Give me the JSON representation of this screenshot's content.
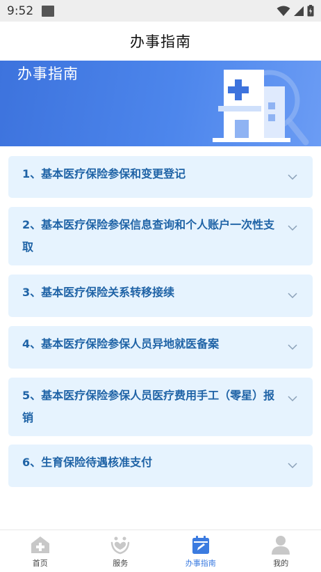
{
  "status_bar": {
    "time": "9:52"
  },
  "header": {
    "title": "办事指南"
  },
  "banner": {
    "title": "办事指南"
  },
  "guide_items": [
    {
      "label": "1、基本医疗保险参保和变更登记"
    },
    {
      "label": "2、基本医疗保险参保信息查询和个人账户一次性支取"
    },
    {
      "label": "3、基本医疗保险关系转移接续"
    },
    {
      "label": "4、基本医疗保险参保人员异地就医备案"
    },
    {
      "label": "5、基本医疗保险参保人员医疗费用手工（零星）报销"
    },
    {
      "label": "6、生育保险待遇核准支付"
    }
  ],
  "bottom_nav": {
    "items": [
      {
        "label": "首页",
        "icon": "home-plus-icon",
        "active": false
      },
      {
        "label": "服务",
        "icon": "service-heart-icon",
        "active": false
      },
      {
        "label": "办事指南",
        "icon": "calendar-edit-icon",
        "active": true
      },
      {
        "label": "我的",
        "icon": "person-icon",
        "active": false
      }
    ]
  },
  "colors": {
    "accent": "#3b7be0",
    "item_bg": "#e6f3fe",
    "item_text": "#1f63a6",
    "banner_start": "#3d73dd",
    "banner_end": "#6b9cf4"
  }
}
